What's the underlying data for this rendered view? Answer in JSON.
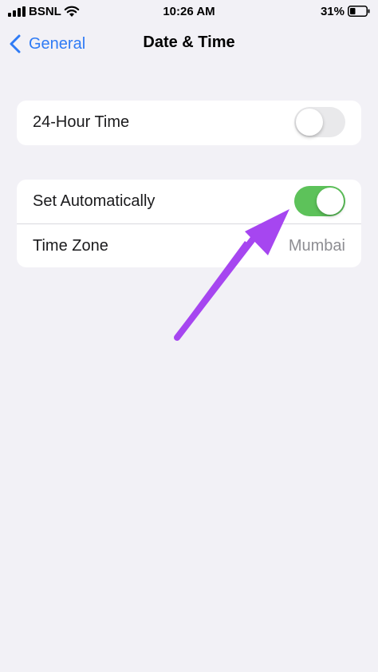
{
  "status_bar": {
    "carrier": "BSNL",
    "time": "10:26 AM",
    "battery_percent": "31%"
  },
  "nav": {
    "back_label": "General",
    "title": "Date & Time"
  },
  "settings": {
    "hour24": {
      "label": "24-Hour Time",
      "enabled": false
    },
    "set_automatically": {
      "label": "Set Automatically",
      "enabled": true
    },
    "time_zone": {
      "label": "Time Zone",
      "value": "Mumbai"
    }
  },
  "colors": {
    "background": "#f2f1f6",
    "accent_blue": "#2f7bf5",
    "toggle_on": "#5dc25a",
    "toggle_off": "#e9e9eb",
    "annotation_arrow": "#a646f0"
  },
  "icons": [
    "signal-bars-icon",
    "wifi-icon",
    "battery-icon",
    "chevron-left-icon",
    "arrow-annotation-icon"
  ]
}
